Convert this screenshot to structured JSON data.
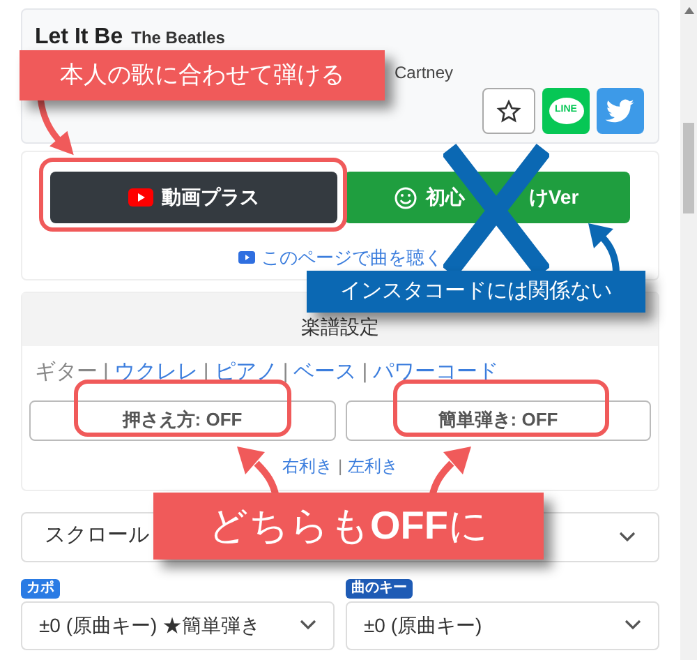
{
  "song": {
    "title": "Let It Be",
    "artist": "The Beatles",
    "credit_fragment": "Cartney"
  },
  "share": {
    "line_logo": "LINE"
  },
  "mode_buttons": [
    {
      "kind": "video",
      "label": "動画プラス"
    },
    {
      "kind": "beginner",
      "label_parts": [
        "初心",
        "けVer"
      ]
    }
  ],
  "listen_link": "このページで曲を聴く",
  "settings": {
    "heading": "楽譜設定",
    "instruments": [
      {
        "label": "ギター",
        "selected": true
      },
      {
        "label": "ウクレレ",
        "selected": false
      },
      {
        "label": "ピアノ",
        "selected": false
      },
      {
        "label": "ベース",
        "selected": false
      },
      {
        "label": "パワーコード",
        "selected": false
      }
    ],
    "toggles": [
      {
        "label": "押さえ方: OFF"
      },
      {
        "label": "簡単弾き: OFF"
      }
    ],
    "hand_links": [
      "右利き",
      "左利き"
    ],
    "separator": "|"
  },
  "scroll_select": {
    "value": "スクロール"
  },
  "capo": {
    "badge": "カポ",
    "value": "±0 (原曲キー) ★簡単弾き"
  },
  "key": {
    "badge": "曲のキー",
    "value": "±0 (原曲キー)"
  },
  "annotations": [
    {
      "kind": "callout",
      "color": "#f05a5a",
      "text": "本人の歌に合わせて弾ける"
    },
    {
      "kind": "callout",
      "color": "#0b68b3",
      "text": "インスタコードには関係ない"
    },
    {
      "kind": "callout",
      "color": "#f05a5a",
      "text": "どちらも**OFF**に"
    }
  ]
}
